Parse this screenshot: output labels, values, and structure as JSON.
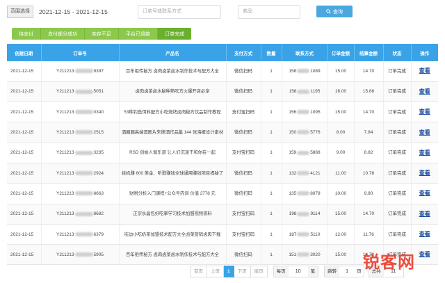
{
  "filter": {
    "date_label": "范围选择",
    "date_range": "2021-12-15 - 2021-12-15",
    "order_placeholder": "订单号或联系方式",
    "product_placeholder": "商品",
    "query_label": "查询",
    "query_icon": "search-icon"
  },
  "tabs": [
    "待支付",
    "支付部分成功",
    "库存不足",
    "平台已退款",
    "订单完成"
  ],
  "table": {
    "headers": [
      "创建日期",
      "订单号",
      "产品名",
      "支付方式",
      "数量",
      "联系方式",
      "订单金额",
      "结算金额",
      "状态",
      "操作"
    ],
    "rows": [
      {
        "date": "2021-12-15",
        "order_prefix": "Y211213",
        "order_suffix": "9397",
        "product": "百年祖传秘方 卤肉卤菜卤水制作技术与配方大全",
        "pay": "微信扫码",
        "qty": "1",
        "phone_prefix": "158",
        "phone_suffix": "1089",
        "amount": "15.00",
        "settle": "14.70",
        "status": "订单完成",
        "action": "查看"
      },
      {
        "date": "2021-12-15",
        "order_prefix": "Y211213",
        "order_suffix": "5051",
        "product": "卤肉卤菜卤水秘种熟吃方火爆开店必享",
        "pay": "微信扫码",
        "qty": "1",
        "phone_prefix": "158",
        "phone_suffix": "1195",
        "amount": "16.00",
        "settle": "15.68",
        "status": "订单完成",
        "action": "查看"
      },
      {
        "date": "2021-12-15",
        "order_prefix": "Y211213",
        "order_suffix": "0340",
        "product": "53种钓鱼饵料配方小吃烧烤卤肉秘方饮品制作教程",
        "pay": "支付宝扫码",
        "qty": "1",
        "phone_prefix": "156",
        "phone_suffix": "1095",
        "amount": "15.00",
        "settle": "14.70",
        "status": "订单完成",
        "action": "查看"
      },
      {
        "date": "2021-12-15",
        "order_prefix": "Y211213",
        "order_suffix": "2515",
        "product": "酒圈圈高端酒图片朱德酒作品集 144 张海报设计素材",
        "pay": "微信扫码",
        "qty": "1",
        "phone_prefix": "150",
        "phone_suffix": "5776",
        "amount": "8.00",
        "settle": "7.84",
        "status": "订单完成",
        "action": "查看"
      },
      {
        "date": "2021-12-15",
        "order_prefix": "Y211213",
        "order_suffix": "3235",
        "product": "RSD 创始人俱乐部 让人们沉迷于和你在一起",
        "pay": "支付宝扫码",
        "qty": "1",
        "phone_prefix": "159",
        "phone_suffix": "5888",
        "amount": "9.00",
        "settle": "8.82",
        "status": "订单完成",
        "action": "查看"
      },
      {
        "date": "2021-12-15",
        "order_prefix": "Y211213",
        "order_suffix": "2924",
        "product": "挂机赚 600 美金、听歌赚钱全球通用赚钱项目揭秘了",
        "pay": "微信扫码",
        "qty": "1",
        "phone_prefix": "132",
        "phone_suffix": "4121",
        "amount": "11.00",
        "settle": "10.78",
        "status": "订单完成",
        "action": "查看"
      },
      {
        "date": "2021-12-15",
        "order_prefix": "Y211213",
        "order_suffix": "8663",
        "product": "财税分析入门课程+公众号内训 价值 2778 元",
        "pay": "微信扫码",
        "qty": "1",
        "phone_prefix": "135",
        "phone_suffix": "8079",
        "amount": "10.00",
        "settle": "9.80",
        "status": "订单完成",
        "action": "查看"
      },
      {
        "date": "2021-12-15",
        "order_prefix": "Y211213",
        "order_suffix": "8682",
        "product": "正宗水晶包好吃掌学习技术加盟视频资料",
        "pay": "支付宝扫码",
        "qty": "1",
        "phone_prefix": "198",
        "phone_suffix": "9114",
        "amount": "15.00",
        "settle": "14.70",
        "status": "订单完成",
        "action": "查看"
      },
      {
        "date": "2021-12-15",
        "order_prefix": "Y211213",
        "order_suffix": "6379",
        "product": "街边小吃奶茶加盟技术配方大全卤菜营销卤肉下载",
        "pay": "支付宝扫码",
        "qty": "1",
        "phone_prefix": "187",
        "phone_suffix": "5110",
        "amount": "12.00",
        "settle": "11.76",
        "status": "订单完成",
        "action": "查看"
      },
      {
        "date": "2021-12-15",
        "order_prefix": "Y211213",
        "order_suffix": "5905",
        "product": "百年祖传秘方 卤肉卤菜卤水制作技术与配方大全",
        "pay": "微信扫码",
        "qty": "1",
        "phone_prefix": "151",
        "phone_suffix": "3020",
        "amount": "15.00",
        "settle": "14.70",
        "status": "订单完成",
        "action": "查看"
      }
    ]
  },
  "pagination": {
    "first": "首页",
    "prev": "上页",
    "current": "1",
    "next": "下页",
    "last": "尾页",
    "per_page_label": "每页",
    "per_page_value": "10",
    "per_page_unit": "笔",
    "jump_label": "跳转",
    "jump_value": "1",
    "jump_unit": "页",
    "total_label": "总共",
    "total_value": "11"
  },
  "watermark": "锐客网"
}
